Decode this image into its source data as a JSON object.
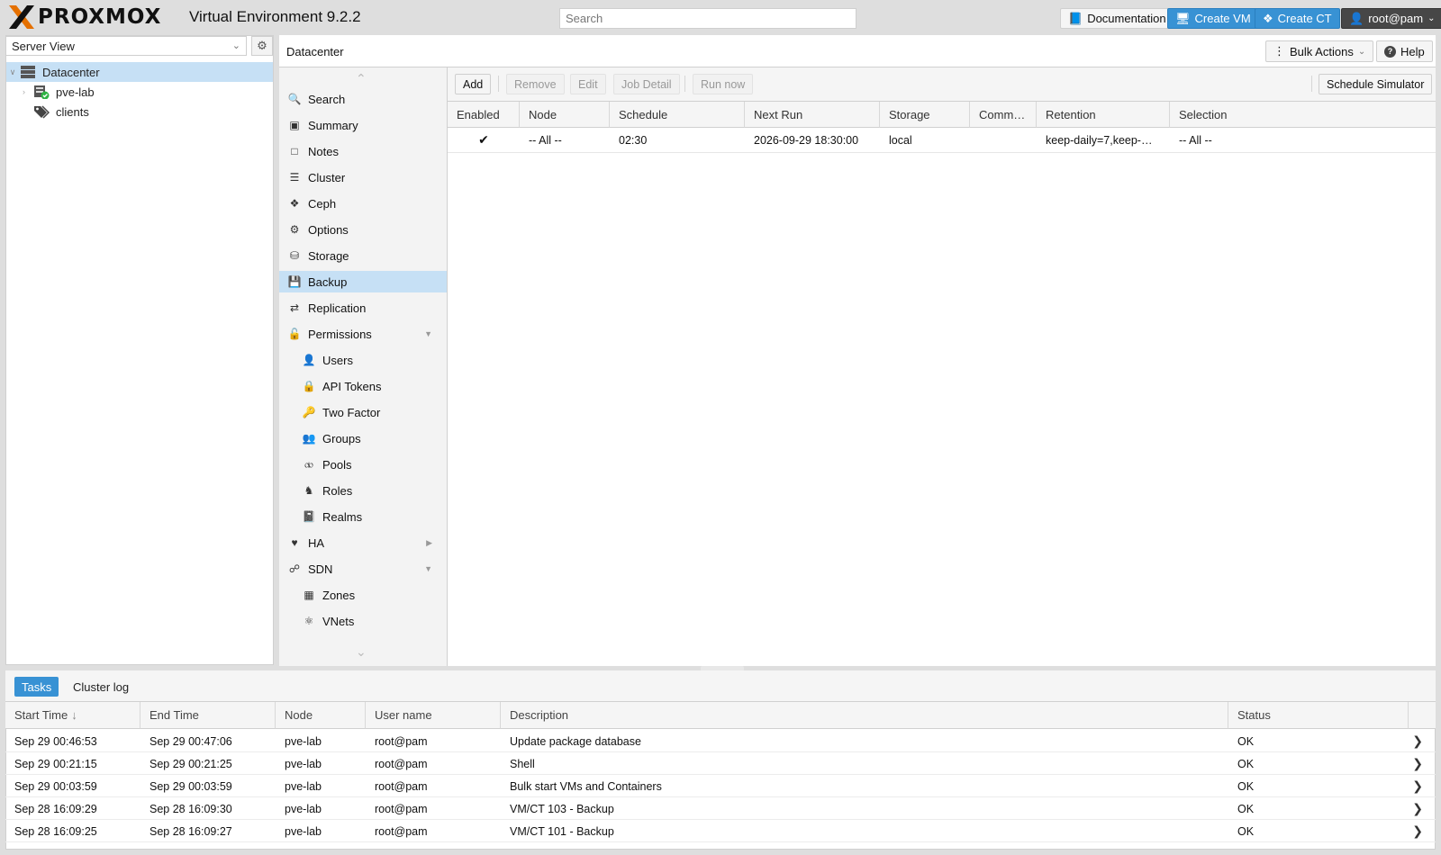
{
  "app": {
    "logo_text": "PROXMOX",
    "version": "Virtual Environment 9.2.2"
  },
  "header": {
    "search_placeholder": "Search",
    "documentation": "Documentation",
    "create_vm": "Create VM",
    "create_ct": "Create CT",
    "user": "root@pam"
  },
  "left": {
    "view": "Server View",
    "tree": [
      {
        "label": "Datacenter",
        "icon": "server-rack-icon"
      },
      {
        "label": "pve-lab",
        "icon": "node-online-icon"
      },
      {
        "label": "clients",
        "icon": "tags-icon"
      }
    ]
  },
  "content": {
    "title": "Datacenter",
    "bulk_actions": "Bulk Actions",
    "help": "Help"
  },
  "nav": [
    {
      "label": "Search",
      "icon": "search-icon",
      "level": 1
    },
    {
      "label": "Summary",
      "icon": "book-icon",
      "level": 1
    },
    {
      "label": "Notes",
      "icon": "note-icon",
      "level": 1
    },
    {
      "label": "Cluster",
      "icon": "cluster-icon",
      "level": 1
    },
    {
      "label": "Ceph",
      "icon": "ceph-icon",
      "level": 1
    },
    {
      "label": "Options",
      "icon": "gear-icon",
      "level": 1
    },
    {
      "label": "Storage",
      "icon": "database-icon",
      "level": 1
    },
    {
      "label": "Backup",
      "icon": "floppy-icon",
      "level": 1,
      "selected": true
    },
    {
      "label": "Replication",
      "icon": "retweet-icon",
      "level": 1
    },
    {
      "label": "Permissions",
      "icon": "unlock-icon",
      "level": 1,
      "expand": "down"
    },
    {
      "label": "Users",
      "icon": "user-icon",
      "level": 2
    },
    {
      "label": "API Tokens",
      "icon": "lock-icon",
      "level": 2
    },
    {
      "label": "Two Factor",
      "icon": "key-icon",
      "level": 2
    },
    {
      "label": "Groups",
      "icon": "users-icon",
      "level": 2
    },
    {
      "label": "Pools",
      "icon": "tags-icon",
      "level": 2
    },
    {
      "label": "Roles",
      "icon": "male-icon",
      "level": 2
    },
    {
      "label": "Realms",
      "icon": "address-book-icon",
      "level": 2
    },
    {
      "label": "HA",
      "icon": "heartbeat-icon",
      "level": 1,
      "expand": "right"
    },
    {
      "label": "SDN",
      "icon": "sdn-icon",
      "level": 1,
      "expand": "down"
    },
    {
      "label": "Zones",
      "icon": "grid-icon",
      "level": 2
    },
    {
      "label": "VNets",
      "icon": "network-icon",
      "level": 2
    }
  ],
  "toolbar": {
    "add": "Add",
    "remove": "Remove",
    "edit": "Edit",
    "job_detail": "Job Detail",
    "run_now": "Run now",
    "schedule_simulator": "Schedule Simulator"
  },
  "backup_grid": {
    "columns": [
      "Enabled",
      "Node",
      "Schedule",
      "Next Run",
      "Storage",
      "Comm…",
      "Retention",
      "Selection"
    ],
    "rows": [
      {
        "enabled": "✔",
        "node": "-- All --",
        "schedule": "02:30",
        "next_run": "2026-09-29 18:30:00",
        "storage": "local",
        "comment": "",
        "retention": "keep-daily=7,keep-…",
        "selection": "-- All --"
      }
    ]
  },
  "bottom": {
    "tabs": [
      "Tasks",
      "Cluster log"
    ],
    "columns": [
      "Start Time",
      "End Time",
      "Node",
      "User name",
      "Description",
      "Status"
    ],
    "rows": [
      {
        "start": "Sep 29 00:46:53",
        "end": "Sep 29 00:47:06",
        "node": "pve-lab",
        "user": "root@pam",
        "desc": "Update package database",
        "status": "OK"
      },
      {
        "start": "Sep 29 00:21:15",
        "end": "Sep 29 00:21:25",
        "node": "pve-lab",
        "user": "root@pam",
        "desc": "Shell",
        "status": "OK"
      },
      {
        "start": "Sep 29 00:03:59",
        "end": "Sep 29 00:03:59",
        "node": "pve-lab",
        "user": "root@pam",
        "desc": "Bulk start VMs and Containers",
        "status": "OK"
      },
      {
        "start": "Sep 28 16:09:29",
        "end": "Sep 28 16:09:30",
        "node": "pve-lab",
        "user": "root@pam",
        "desc": "VM/CT 103 - Backup",
        "status": "OK"
      },
      {
        "start": "Sep 28 16:09:25",
        "end": "Sep 28 16:09:27",
        "node": "pve-lab",
        "user": "root@pam",
        "desc": "VM/CT 101 - Backup",
        "status": "OK"
      }
    ]
  },
  "colors": {
    "accent_blue": "#3892d4",
    "selection_blue": "#c6e0f5",
    "logo_orange": "#e57000",
    "online_green": "#2fb344"
  }
}
